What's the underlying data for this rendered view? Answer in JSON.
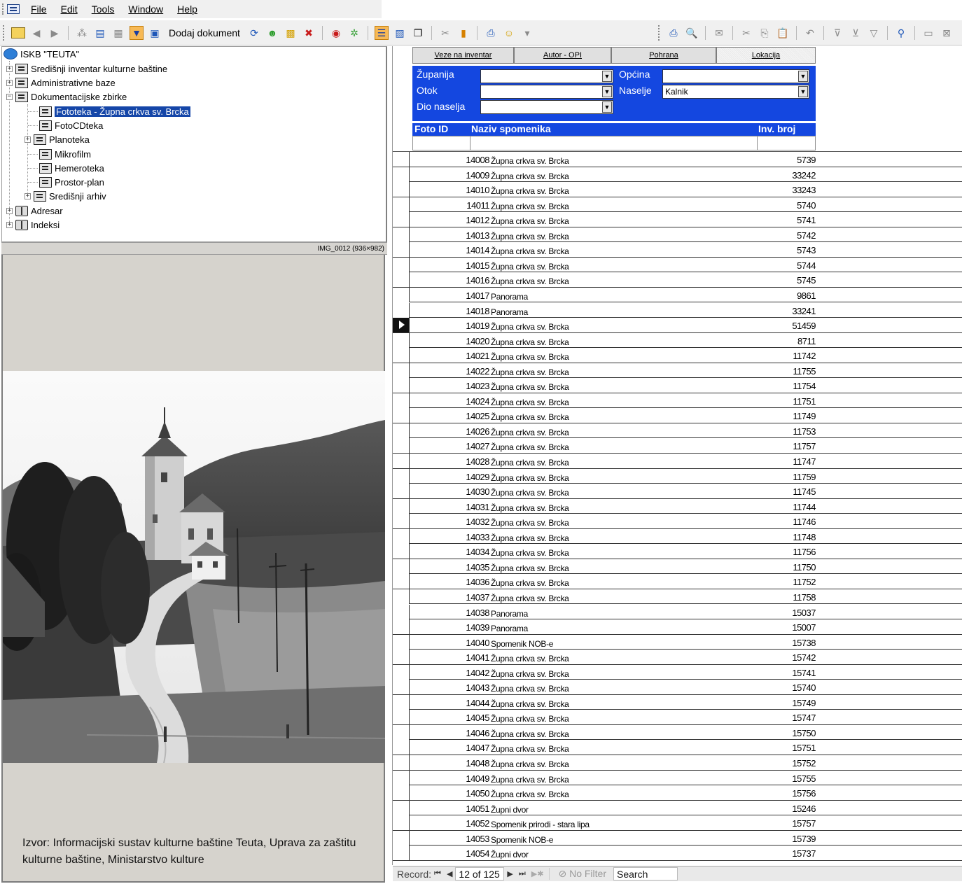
{
  "menu": {
    "items": [
      "File",
      "Edit",
      "Tools",
      "Window",
      "Help"
    ]
  },
  "toolbar": {
    "dodaj_dokument_label": "Dodaj dokument"
  },
  "tree": {
    "root": "ISKB \"TEUTA\"",
    "nodes": [
      {
        "label": "Središnji inventar kulturne baštine",
        "expander": "+"
      },
      {
        "label": "Administrativne baze",
        "expander": "+"
      },
      {
        "label": "Dokumentacijske zbirke",
        "expander": "−"
      },
      {
        "label": "Fototeka - Župna crkva sv. Brcka",
        "selected": true
      },
      {
        "label": "FotoCDteka"
      },
      {
        "label": "Planoteka",
        "expander": "+"
      },
      {
        "label": "Mikrofilm"
      },
      {
        "label": "Hemeroteka"
      },
      {
        "label": "Prostor-plan"
      },
      {
        "label": "Središnji arhiv",
        "expander": "+"
      },
      {
        "label": "Adresar",
        "expander": "+"
      },
      {
        "label": "Indeksi",
        "expander": "+"
      }
    ]
  },
  "image_panel": {
    "filename": "IMG_0012 (936×982)",
    "caption": "Izvor: Informacijski sustav kulturne baštine Teuta, Uprava za zaštitu kulturne baštine, Ministarstvo kulture"
  },
  "tabs": [
    "Veze na inventar",
    "Autor - OPI",
    "Pohrana",
    "Lokacija"
  ],
  "active_tab": "Lokacija",
  "filters": {
    "zupanija_label": "Županija",
    "otok_label": "Otok",
    "dio_naselja_label": "Dio naselja",
    "opcina_label": "Općina",
    "naselje_label": "Naselje",
    "zupanija_value": "",
    "otok_value": "",
    "dio_naselja_value": "",
    "opcina_value": "",
    "naselje_value": "Kalnik"
  },
  "grid": {
    "columns": [
      "Foto ID",
      "Naziv spomenika",
      "Inv. broj"
    ],
    "current_row_index": 11,
    "rows": [
      [
        "14008",
        "Župna crkva sv. Brcka",
        "5739"
      ],
      [
        "14009",
        "Župna crkva sv. Brcka",
        "33242"
      ],
      [
        "14010",
        "Župna crkva sv. Brcka",
        "33243"
      ],
      [
        "14011",
        "Župna crkva sv. Brcka",
        "5740"
      ],
      [
        "14012",
        "Župna crkva sv. Brcka",
        "5741"
      ],
      [
        "14013",
        "Župna crkva sv. Brcka",
        "5742"
      ],
      [
        "14014",
        "Župna crkva sv. Brcka",
        "5743"
      ],
      [
        "14015",
        "Župna crkva sv. Brcka",
        "5744"
      ],
      [
        "14016",
        "Župna crkva sv. Brcka",
        "5745"
      ],
      [
        "14017",
        "Panorama",
        "9861"
      ],
      [
        "14018",
        "Panorama",
        "33241"
      ],
      [
        "14019",
        "Župna crkva sv. Brcka",
        "51459"
      ],
      [
        "14020",
        "Župna crkva sv. Brcka",
        "8711"
      ],
      [
        "14021",
        "Župna crkva sv. Brcka",
        "11742"
      ],
      [
        "14022",
        "Župna crkva sv. Brcka",
        "11755"
      ],
      [
        "14023",
        "Župna crkva sv. Brcka",
        "11754"
      ],
      [
        "14024",
        "Župna crkva sv. Brcka",
        "11751"
      ],
      [
        "14025",
        "Župna crkva sv. Brcka",
        "11749"
      ],
      [
        "14026",
        "Župna crkva sv. Brcka",
        "11753"
      ],
      [
        "14027",
        "Župna crkva sv. Brcka",
        "11757"
      ],
      [
        "14028",
        "Župna crkva sv. Brcka",
        "11747"
      ],
      [
        "14029",
        "Župna crkva sv. Brcka",
        "11759"
      ],
      [
        "14030",
        "Župna crkva sv. Brcka",
        "11745"
      ],
      [
        "14031",
        "Župna crkva sv. Brcka",
        "11744"
      ],
      [
        "14032",
        "Župna crkva sv. Brcka",
        "11746"
      ],
      [
        "14033",
        "Župna crkva sv. Brcka",
        "11748"
      ],
      [
        "14034",
        "Župna crkva sv. Brcka",
        "11756"
      ],
      [
        "14035",
        "Župna crkva sv. Brcka",
        "11750"
      ],
      [
        "14036",
        "Župna crkva sv. Brcka",
        "11752"
      ],
      [
        "14037",
        "Župna crkva sv. Brcka",
        "11758"
      ],
      [
        "14038",
        "Panorama",
        "15037"
      ],
      [
        "14039",
        "Panorama",
        "15007"
      ],
      [
        "14040",
        "Spomenik NOB-e",
        "15738"
      ],
      [
        "14041",
        "Župna crkva sv. Brcka",
        "15742"
      ],
      [
        "14042",
        "Župna crkva sv. Brcka",
        "15741"
      ],
      [
        "14043",
        "Župna crkva sv. Brcka",
        "15740"
      ],
      [
        "14044",
        "Župna crkva sv. Brcka",
        "15749"
      ],
      [
        "14045",
        "Župna crkva sv. Brcka",
        "15747"
      ],
      [
        "14046",
        "Župna crkva sv. Brcka",
        "15750"
      ],
      [
        "14047",
        "Župna crkva sv. Brcka",
        "15751"
      ],
      [
        "14048",
        "Župna crkva sv. Brcka",
        "15752"
      ],
      [
        "14049",
        "Župna crkva sv. Brcka",
        "15755"
      ],
      [
        "14050",
        "Župna crkva sv. Brcka",
        "15756"
      ],
      [
        "14051",
        "Župni dvor",
        "15246"
      ],
      [
        "14052",
        "Spomenik prirodi - stara lipa",
        "15757"
      ],
      [
        "14053",
        "Spomenik NOB-e",
        "15739"
      ],
      [
        "14054",
        "Župni dvor",
        "15737"
      ]
    ]
  },
  "navigation": {
    "record_label": "Record:",
    "position": "12 of 125",
    "filter_label": "No Filter",
    "search_label": "Search"
  }
}
